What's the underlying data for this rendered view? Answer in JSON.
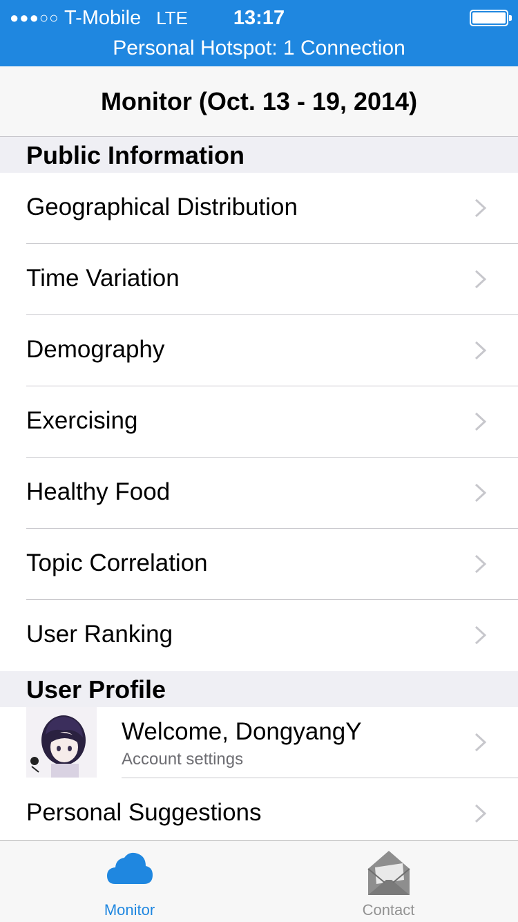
{
  "status_bar": {
    "signal": "●●●○○",
    "carrier": "T-Mobile",
    "network": "LTE",
    "time": "13:17",
    "hotspot": "Personal Hotspot: 1 Connection",
    "color": "#1f87e0"
  },
  "nav": {
    "title": "Monitor (Oct. 13 - 19, 2014)"
  },
  "sections": {
    "public": {
      "header": "Public Information",
      "items": [
        {
          "label": "Geographical Distribution"
        },
        {
          "label": "Time Variation"
        },
        {
          "label": "Demography"
        },
        {
          "label": "Exercising"
        },
        {
          "label": "Healthy Food"
        },
        {
          "label": "Topic Correlation"
        },
        {
          "label": "User Ranking"
        }
      ]
    },
    "profile": {
      "header": "User Profile",
      "welcome": "Welcome, DongyangY",
      "account_settings": "Account settings",
      "suggestions": "Personal Suggestions"
    }
  },
  "tabbar": {
    "tabs": [
      {
        "label": "Monitor",
        "icon": "cloud-icon",
        "active": true
      },
      {
        "label": "Contact",
        "icon": "envelope-icon",
        "active": false
      }
    ],
    "active_color": "#1f87e0",
    "inactive_color": "#929292"
  }
}
